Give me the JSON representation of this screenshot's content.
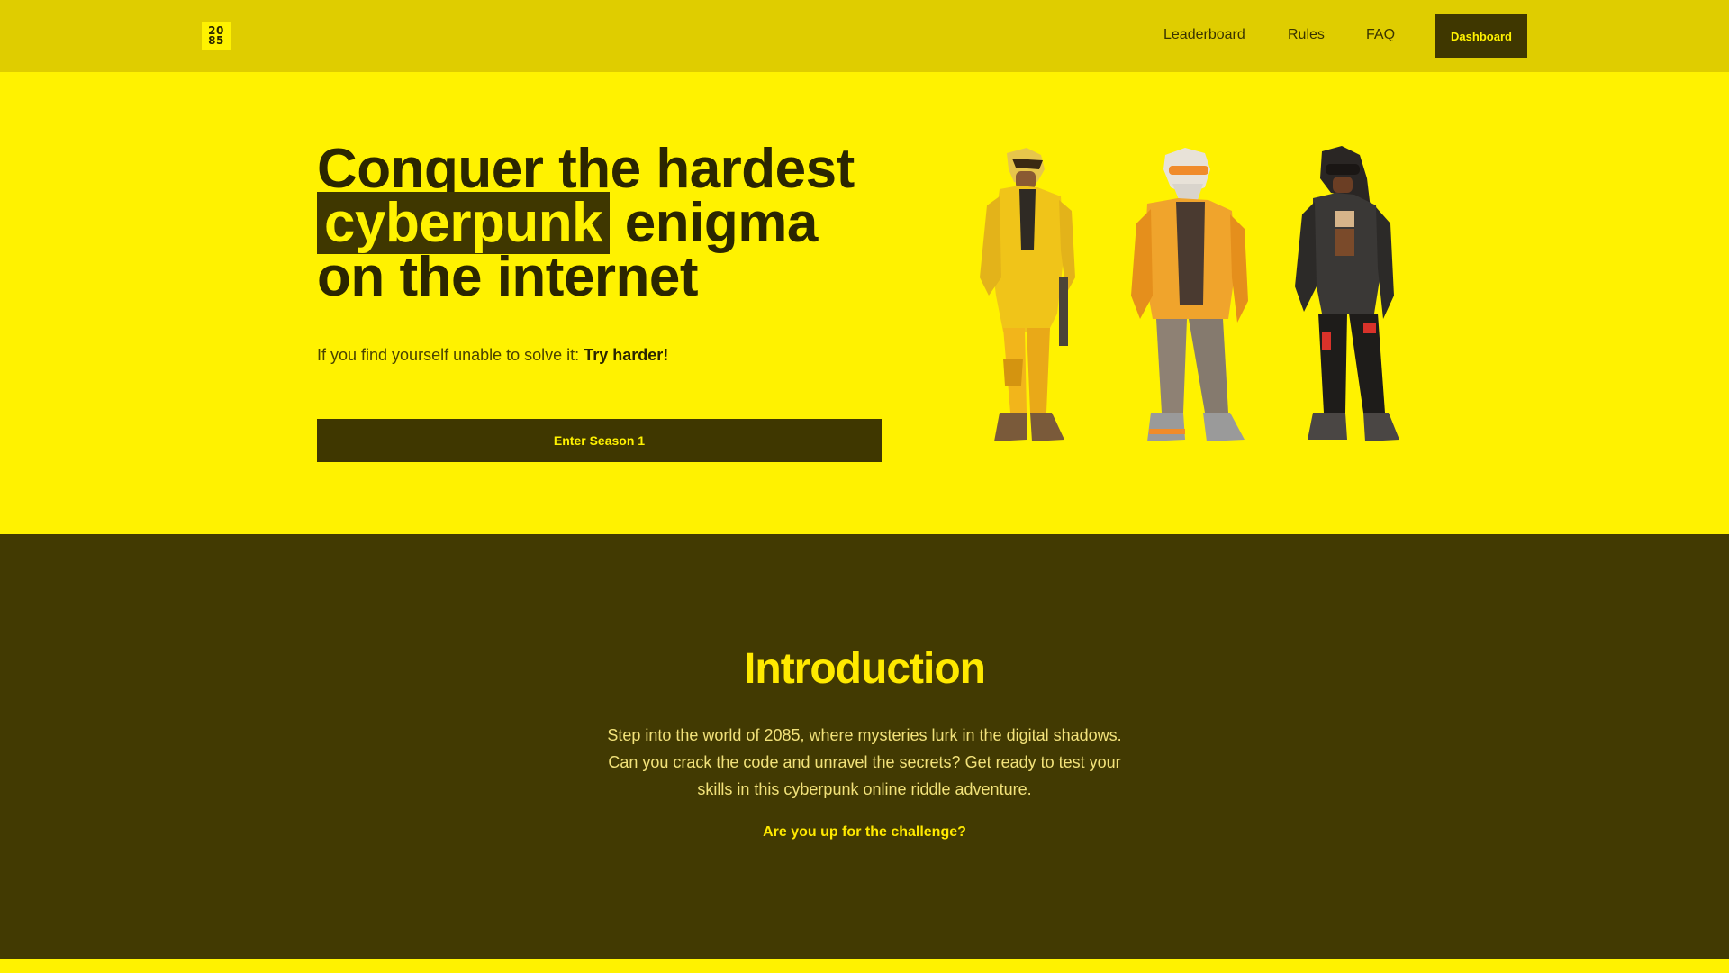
{
  "header": {
    "logo_top": "20",
    "logo_bottom": "85",
    "nav": {
      "leaderboard": "Leaderboard",
      "rules": "Rules",
      "faq": "FAQ"
    },
    "dashboard_label": "Dashboard"
  },
  "hero": {
    "title_part1": "Conquer the hardest",
    "title_highlight": "cyberpunk",
    "title_part2": "enigma on the internet",
    "subtitle_prefix": "If you find yourself unable to solve it:",
    "subtitle_emphasis": "Try harder!",
    "cta_label": "Enter Season 1",
    "characters": [
      "yellow-jacket-character",
      "orange-jacket-character",
      "black-jacket-character"
    ]
  },
  "intro": {
    "title": "Introduction",
    "body": "Step into the world of 2085, where mysteries lurk in the digital shadows. Can you crack the code and unravel the secrets? Get ready to test your skills in this cyberpunk online riddle adventure.",
    "question": "Are you up for the challenge?"
  },
  "colors": {
    "hero_bg": "#fff200",
    "header_bg": "#dfcd00",
    "dark": "#423a02",
    "accent_text": "#ffe900"
  }
}
